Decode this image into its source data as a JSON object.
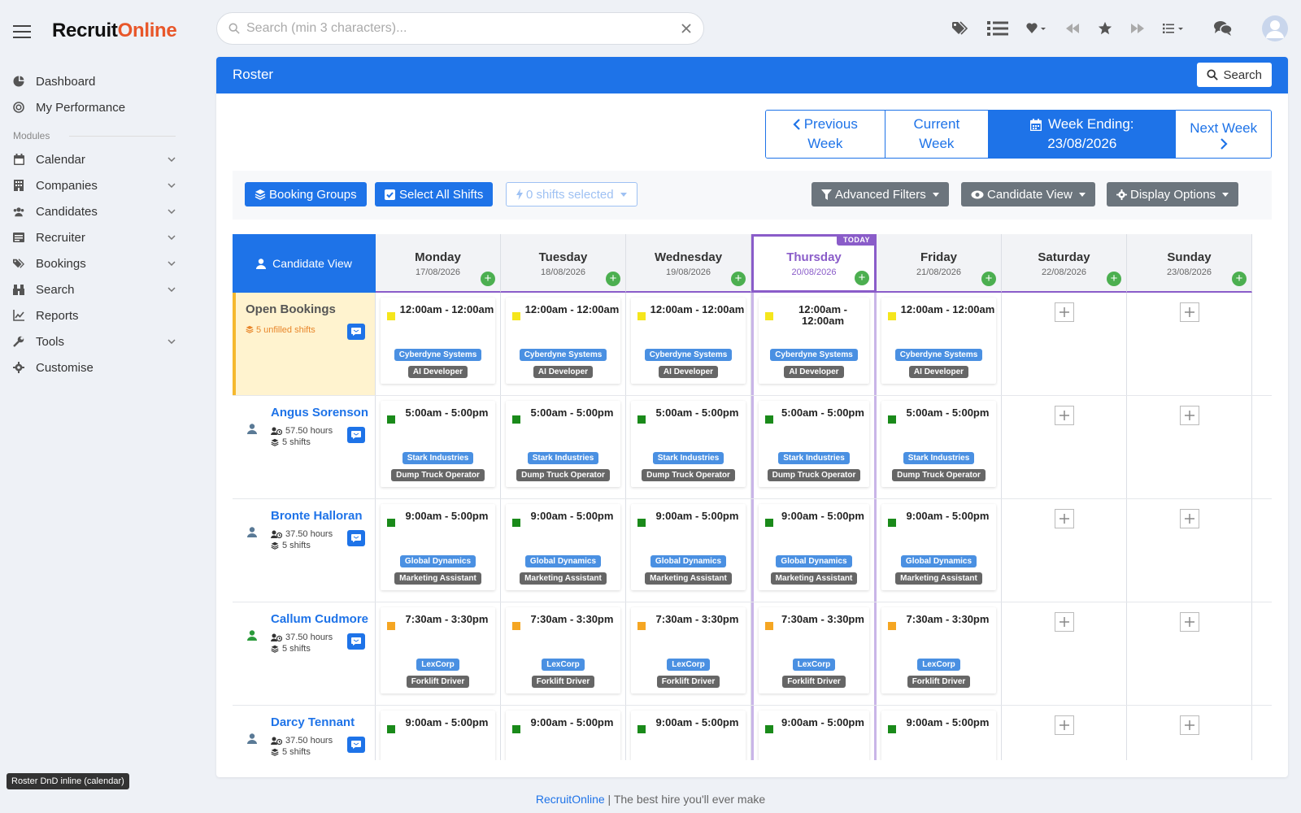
{
  "brand": {
    "part1": "Recruit",
    "part2": "Online"
  },
  "search": {
    "placeholder": "Search (min 3 characters)..."
  },
  "sidebar": {
    "top_items": [
      {
        "label": "Dashboard",
        "icon": "dashboard-icon"
      },
      {
        "label": "My Performance",
        "icon": "performance-icon"
      }
    ],
    "section_label": "Modules",
    "modules": [
      {
        "label": "Calendar",
        "icon": "calendar-icon"
      },
      {
        "label": "Companies",
        "icon": "building-icon"
      },
      {
        "label": "Candidates",
        "icon": "users-icon"
      },
      {
        "label": "Recruiter",
        "icon": "id-card-icon"
      },
      {
        "label": "Bookings",
        "icon": "tags-icon"
      },
      {
        "label": "Search",
        "icon": "binoculars-icon"
      },
      {
        "label": "Reports",
        "icon": "chart-line-icon"
      },
      {
        "label": "Tools",
        "icon": "wrench-icon"
      },
      {
        "label": "Customise",
        "icon": "gear-icon"
      }
    ]
  },
  "tooltip": "Roster DnD inline (calendar)",
  "panel": {
    "title": "Roster",
    "search_label": "Search"
  },
  "week_nav": {
    "previous": {
      "line1": "Previous",
      "line2": "Week"
    },
    "current": {
      "line1": "Current",
      "line2": "Week"
    },
    "ending": {
      "line1": "Week Ending:",
      "line2": "23/08/2026"
    },
    "next": {
      "line1": "Next Week"
    }
  },
  "toolbar": {
    "booking_groups": "Booking Groups",
    "select_all": "Select All Shifts",
    "selected": "0 shifts selected",
    "advanced_filters": "Advanced Filters",
    "candidate_view": "Candidate View",
    "display_options": "Display Options"
  },
  "grid": {
    "corner_label": "Candidate View",
    "today_badge": "TODAY",
    "days": [
      {
        "name": "Monday",
        "date": "17/08/2026"
      },
      {
        "name": "Tuesday",
        "date": "18/08/2026"
      },
      {
        "name": "Wednesday",
        "date": "19/08/2026"
      },
      {
        "name": "Thursday",
        "date": "20/08/2026"
      },
      {
        "name": "Friday",
        "date": "21/08/2026"
      },
      {
        "name": "Saturday",
        "date": "22/08/2026"
      },
      {
        "name": "Sunday",
        "date": "23/08/2026"
      }
    ],
    "open_bookings": {
      "title": "Open Bookings",
      "unfilled": "5 unfilled shifts"
    },
    "rows": [
      {
        "type": "open",
        "time": "12:00am - 12:00am",
        "company": "Cyberdyne Systems",
        "role": "AI Developer",
        "color": "#f5e61c"
      },
      {
        "type": "candidate",
        "name": "Angus Sorenson",
        "hours": "57.50 hours",
        "shifts": "5 shifts",
        "time": "5:00am - 5:00pm",
        "company": "Stark Industries",
        "role": "Dump Truck Operator",
        "color": "#1a8a1a",
        "avatar_color": "#5a7a96"
      },
      {
        "type": "candidate",
        "name": "Bronte Halloran",
        "hours": "37.50 hours",
        "shifts": "5 shifts",
        "time": "9:00am - 5:00pm",
        "company": "Global Dynamics",
        "role": "Marketing Assistant",
        "color": "#1a8a1a",
        "avatar_color": "#5a7a96"
      },
      {
        "type": "candidate",
        "name": "Callum Cudmore",
        "hours": "37.50 hours",
        "shifts": "5 shifts",
        "time": "7:30am - 3:30pm",
        "company": "LexCorp",
        "role": "Forklift Driver",
        "color": "#f5a623",
        "avatar_color": "#2a9a3a"
      },
      {
        "type": "candidate",
        "name": "Darcy Tennant",
        "hours": "37.50 hours",
        "shifts": "5 shifts",
        "time": "9:00am - 5:00pm",
        "company": "",
        "role": "",
        "color": "#1a8a1a",
        "avatar_color": "#5a7a96"
      }
    ]
  },
  "footer": {
    "brand": "RecruitOnline",
    "tagline": " | The best hire you'll ever make"
  }
}
